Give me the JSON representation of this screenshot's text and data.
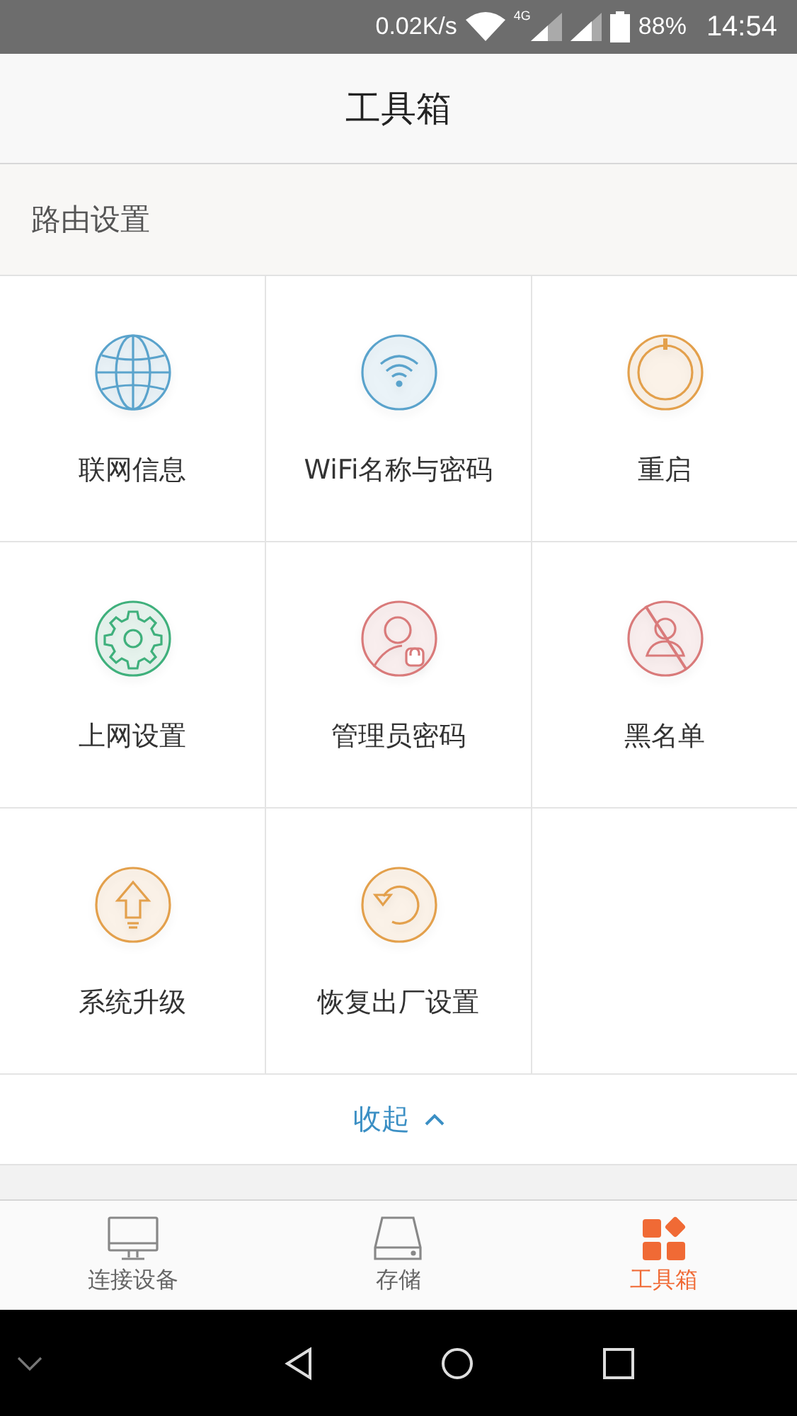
{
  "status_bar": {
    "speed": "0.02K/s",
    "network": "4G",
    "battery": "88%",
    "time": "14:54"
  },
  "header": {
    "title": "工具箱"
  },
  "section": {
    "title": "路由设置"
  },
  "tools": [
    {
      "label": "联网信息",
      "kind": "globe",
      "color": "#5aa3cc"
    },
    {
      "label": "WiFi名称与密码",
      "kind": "wifi",
      "color": "#5aa3cc"
    },
    {
      "label": "重启",
      "kind": "power",
      "color": "#e3a04c"
    },
    {
      "label": "上网设置",
      "kind": "gear",
      "color": "#3fb07c"
    },
    {
      "label": "管理员密码",
      "kind": "admin",
      "color": "#d97a7a"
    },
    {
      "label": "黑名单",
      "kind": "blacklist",
      "color": "#d97a7a"
    },
    {
      "label": "系统升级",
      "kind": "upgrade",
      "color": "#e3a04c"
    },
    {
      "label": "恢复出厂设置",
      "kind": "restore",
      "color": "#e3a04c"
    }
  ],
  "collapse": {
    "label": "收起"
  },
  "tabs": [
    {
      "label": "连接设备",
      "kind": "devices",
      "selected": false
    },
    {
      "label": "存储",
      "kind": "storage",
      "selected": false
    },
    {
      "label": "工具箱",
      "kind": "toolbox",
      "selected": true
    }
  ]
}
